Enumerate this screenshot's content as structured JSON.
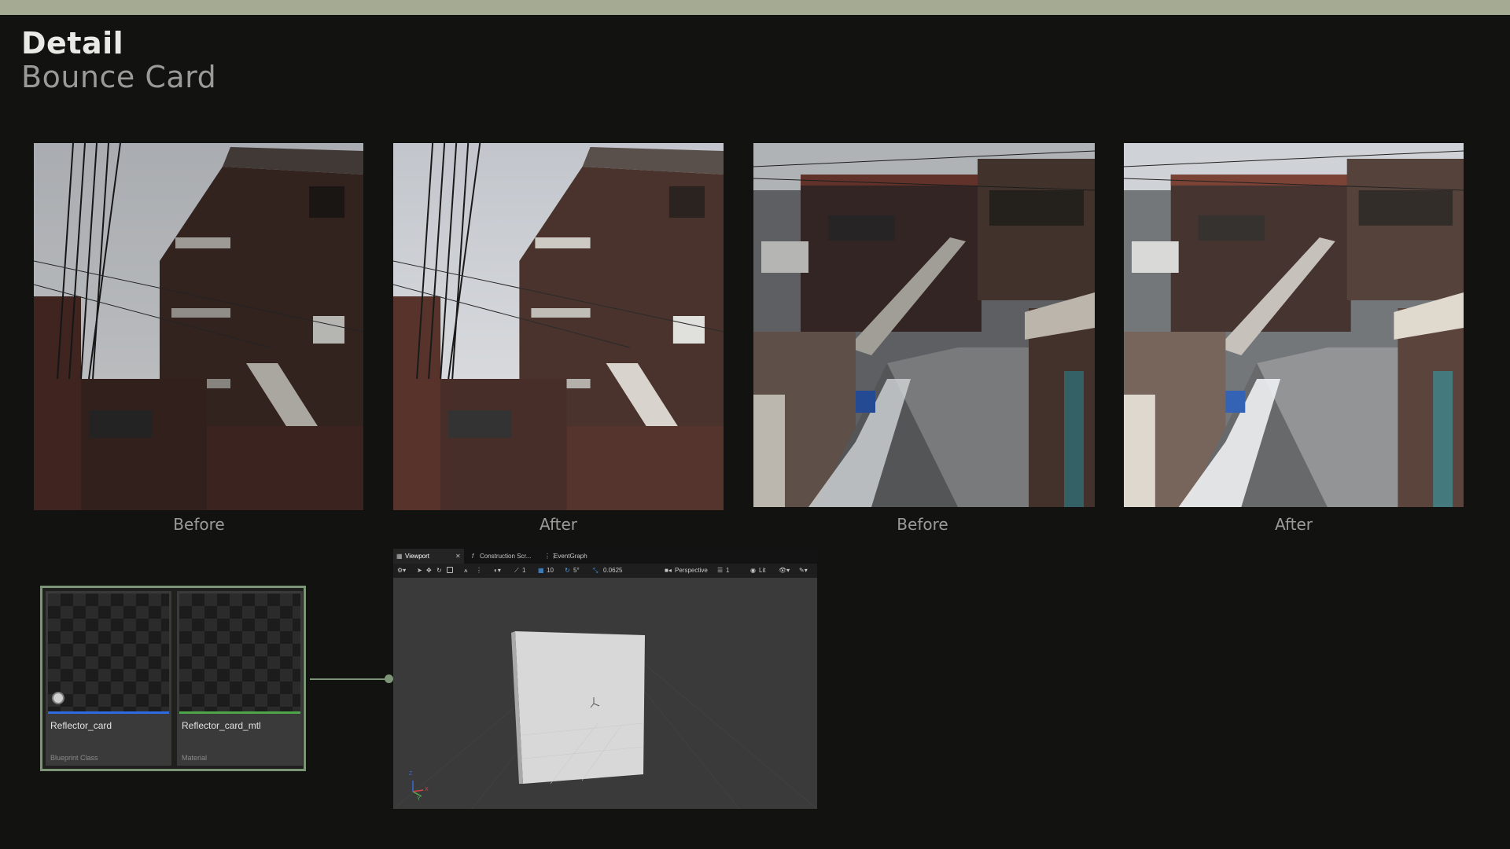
{
  "header": {
    "title": "Detail",
    "subtitle": "Bounce Card"
  },
  "gallery": [
    {
      "caption": "Before",
      "scene": "brick-building"
    },
    {
      "caption": "After",
      "scene": "brick-building"
    },
    {
      "caption": "Before",
      "scene": "alley-stairs"
    },
    {
      "caption": "After",
      "scene": "alley-stairs"
    }
  ],
  "assets": [
    {
      "name": "Reflector_card",
      "type": "Blueprint Class",
      "strip_color": "#2f6be0"
    },
    {
      "name": "Reflector_card_mtl",
      "type": "Material",
      "strip_color": "#4fa64a"
    }
  ],
  "viewport": {
    "tabs": [
      "Viewport",
      "Construction Scr...",
      "EventGraph"
    ],
    "toolbar": {
      "rotation_snap": "1",
      "location_snap": "10",
      "angle_snap": "5°",
      "scale_snap": "0.0625",
      "perspective": "Perspective",
      "lit": "Lit",
      "camera_speed": "1"
    },
    "axis_labels": [
      "Z",
      "Y",
      "X"
    ]
  },
  "colors": {
    "accent": "#7c9577",
    "topbar": "#a4ab92",
    "background": "#121311"
  }
}
